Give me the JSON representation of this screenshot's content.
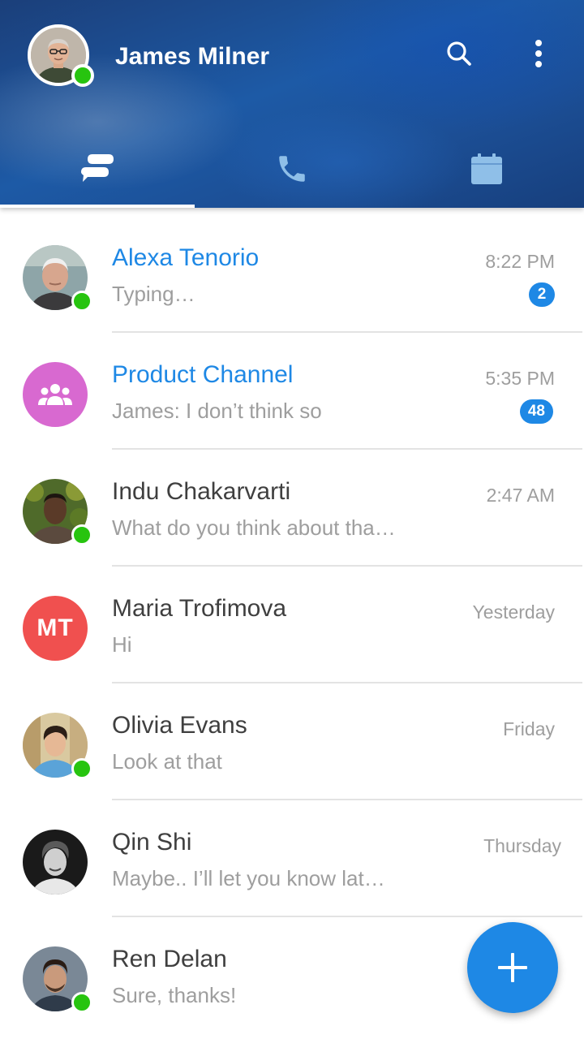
{
  "header": {
    "user_name": "James Milner",
    "online": true,
    "icons": [
      "search-icon",
      "more-vert-icon"
    ]
  },
  "tabs": [
    {
      "name": "chats",
      "icon": "chat-bubbles-icon",
      "active": true
    },
    {
      "name": "calls",
      "icon": "phone-icon",
      "active": false
    },
    {
      "name": "calendar",
      "icon": "calendar-icon",
      "active": false
    }
  ],
  "colors": {
    "accent": "#1e88e5",
    "online": "#27c40f",
    "group_avatar": "#d869d0",
    "initials_avatar": "#f0504f"
  },
  "conversations": [
    {
      "name": "Alexa Tenorio",
      "preview": "Typing…",
      "time": "8:22 PM",
      "badge": "2",
      "unread": true,
      "online": true
    },
    {
      "name": "Product Channel",
      "preview": "James: I don’t think so",
      "time": "5:35 PM",
      "badge": "48",
      "unread": true,
      "online": false
    },
    {
      "name": "Indu Chakarvarti",
      "preview": "What do you think about tha…",
      "time": "2:47 AM",
      "unread": false,
      "online": true
    },
    {
      "name": "Maria Trofimova",
      "initials": "MT",
      "preview": "Hi",
      "time": "Yesterday",
      "unread": false,
      "online": false
    },
    {
      "name": "Olivia Evans",
      "preview": "Look at that",
      "time": "Friday",
      "unread": false,
      "online": true
    },
    {
      "name": "Qin Shi",
      "preview": "Maybe.. I’ll let you know lat…",
      "time": "Thursday",
      "unread": false,
      "online": false
    },
    {
      "name": "Ren Delan",
      "preview": "Sure, thanks!",
      "time": "",
      "unread": false,
      "online": true
    }
  ],
  "fab": {
    "icon": "plus-icon"
  }
}
